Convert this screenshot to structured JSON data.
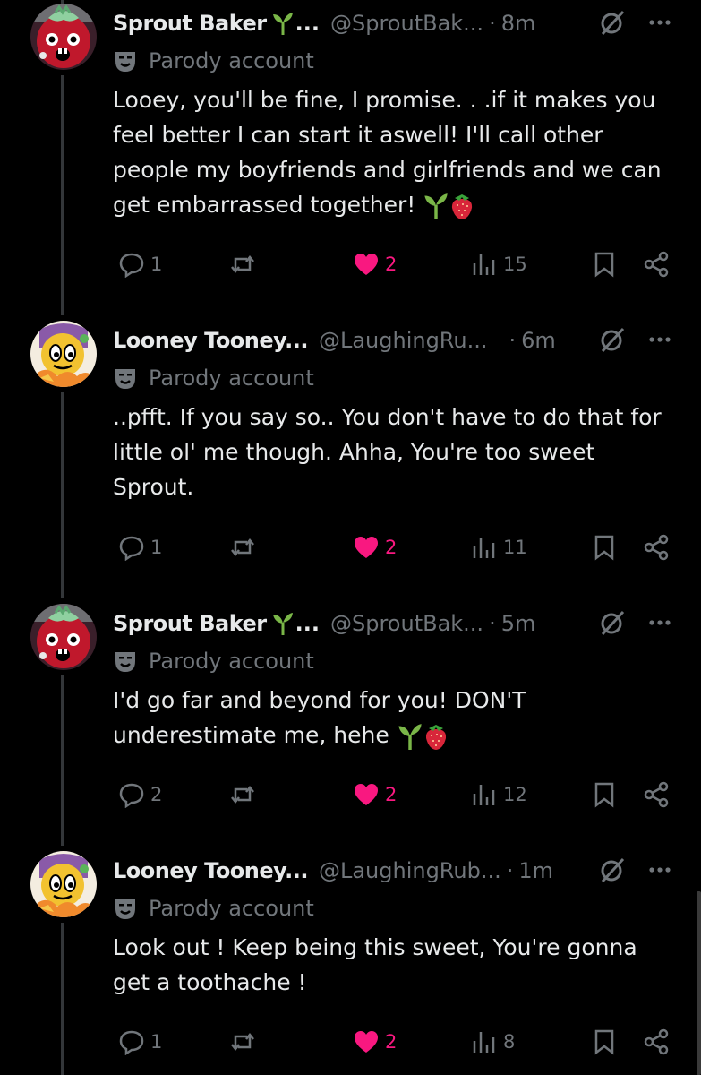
{
  "posts": [
    {
      "name": "Sprout Baker",
      "handle": "@SproutBak...",
      "time": "8m",
      "badge": "Parody account",
      "text": "Looey, you'll be fine, I promise. . .if it makes you feel better I can start it aswell! I'll call other people my boyfriends and girlfriends and we can get embarrassed together!",
      "trailing_emoji": [
        "seedling-icon",
        "strawberry-icon"
      ],
      "replies": "1",
      "likes": "2",
      "views": "15",
      "avatar": "sprout-avatar"
    },
    {
      "name": "Looney Tooney...",
      "handle": "@LaughingRu...",
      "time": "6m",
      "badge": "Parody account",
      "text": "..pfft. If you say so.. You don't have to do that for little ol' me though. Ahha, You're too sweet Sprout.",
      "trailing_emoji": [],
      "replies": "1",
      "likes": "2",
      "views": "11",
      "avatar": "looney-avatar"
    },
    {
      "name": "Sprout Baker",
      "handle": "@SproutBak...",
      "time": "5m",
      "badge": "Parody account",
      "text": "I'd go far and beyond for you! DON'T underestimate me, hehe",
      "trailing_emoji": [
        "seedling-icon",
        "strawberry-icon"
      ],
      "replies": "2",
      "likes": "2",
      "views": "12",
      "avatar": "sprout-avatar"
    },
    {
      "name": "Looney Tooney...",
      "handle": "@LaughingRub...",
      "time": "1m",
      "badge": "Parody account",
      "text": "Look out ! Keep being this sweet, You're gonna get a toothache !",
      "trailing_emoji": [],
      "replies": "1",
      "likes": "2",
      "views": "8",
      "avatar": "looney-avatar"
    }
  ],
  "separator": "·",
  "colors": {
    "background": "#000000",
    "text": "#e7e9ea",
    "muted": "#71767b",
    "like": "#f91880",
    "thread_line": "#333639",
    "seedling": "#7ab648",
    "strawberry": "#d8263a"
  }
}
